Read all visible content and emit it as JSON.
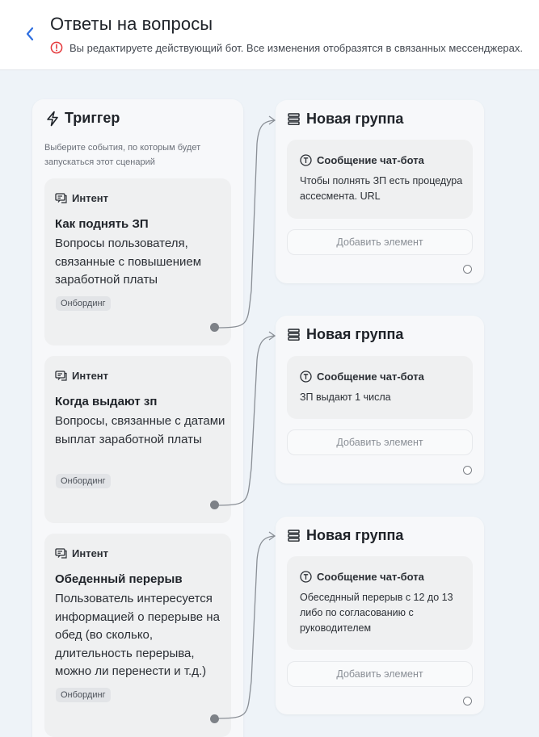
{
  "header": {
    "title": "Ответы на вопросы",
    "warning": "Вы редактируете действующий бот. Все изменения отобразятся в связанных мессенджерах."
  },
  "trigger": {
    "title": "Триггер",
    "description": "Выберите события, по которым будет запускаться этот сценарий",
    "intents": [
      {
        "type_label": "Интент",
        "name": "Как поднять ЗП",
        "description": "Вопросы пользователя, связанные с повышением заработной платы",
        "tag": "Онбординг"
      },
      {
        "type_label": "Интент",
        "name": "Когда выдают зп",
        "description": "Вопросы, связанные с датами выплат заработной платы",
        "tag": "Онбординг"
      },
      {
        "type_label": "Интент",
        "name": "Обеденный перерыв",
        "description": "Пользователь интересуется информацией о перерыве на обед (во сколько, длительность перерыва, можно ли перенести и т.д.)",
        "tag": "Онбординг"
      }
    ]
  },
  "groups": [
    {
      "title": "Новая группа",
      "message_label": "Сообщение чат-бота",
      "message_text": "Чтобы полнять ЗП есть процедура ассесмента. URL",
      "add_label": "Добавить элемент"
    },
    {
      "title": "Новая группа",
      "message_label": "Сообщение чат-бота",
      "message_text": "ЗП выдают 1 числа",
      "add_label": "Добавить элемент"
    },
    {
      "title": "Новая группа",
      "message_label": "Сообщение чат-бота",
      "message_text": "Обеседнный перерыв с 12 до 13 либо по согласованию с руководителем",
      "add_label": "Добавить элемент"
    }
  ],
  "icons": {
    "back": "chevron-left-icon",
    "warning": "alert-circle-icon",
    "trigger": "lightning-icon",
    "intent": "chat-intent-icon",
    "group": "stack-icon",
    "message": "text-t-icon"
  },
  "colors": {
    "accent": "#2f6fe0",
    "warning": "#e5383b",
    "canvas": "#eef3f8"
  }
}
